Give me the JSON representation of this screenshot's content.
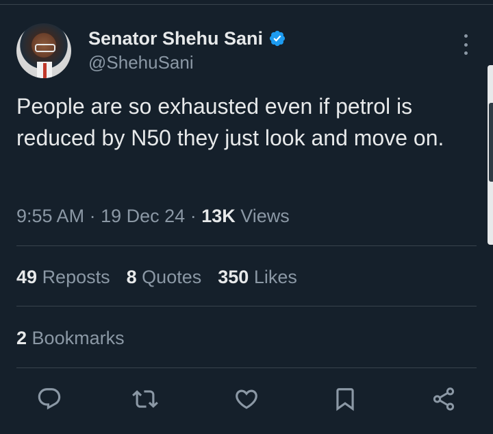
{
  "author": {
    "display_name": "Senator Shehu Sani",
    "handle": "@ShehuSani",
    "verified_icon": "verified-badge-icon"
  },
  "tweet": {
    "text": "People are so exhausted even if petrol is reduced by N50 they just look and move on.",
    "time": "9:55 AM",
    "date": "19 Dec 24",
    "separator": "·",
    "views_count": "13K",
    "views_label": "Views"
  },
  "stats": {
    "reposts_count": "49",
    "reposts_label": "Reposts",
    "quotes_count": "8",
    "quotes_label": "Quotes",
    "likes_count": "350",
    "likes_label": "Likes",
    "bookmarks_count": "2",
    "bookmarks_label": "Bookmarks"
  },
  "actions": [
    "reply-icon",
    "repost-icon",
    "like-icon",
    "bookmark-icon",
    "share-icon"
  ],
  "colors": {
    "background": "#15202b",
    "text": "#e7e9ea",
    "secondary": "#8b98a5",
    "divider": "#38444d",
    "verified": "#1d9bf0"
  }
}
